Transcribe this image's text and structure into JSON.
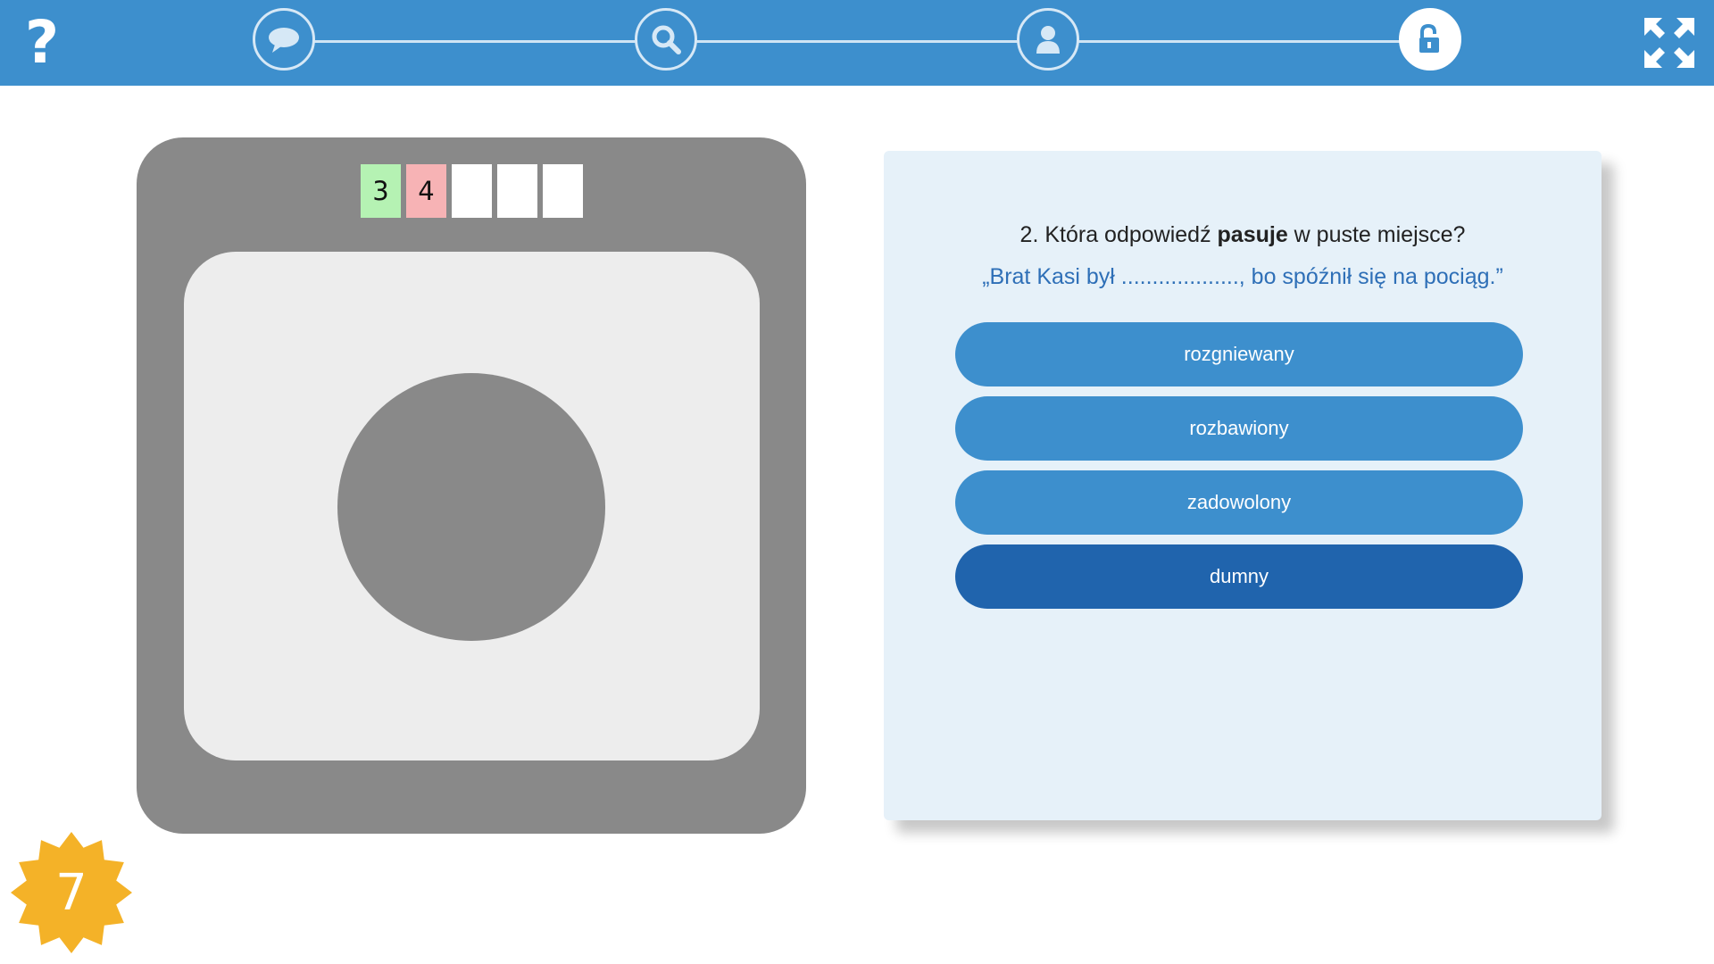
{
  "toolbar": {
    "help_label": "?",
    "steps": [
      {
        "icon": "speech-bubble-icon",
        "state": "done"
      },
      {
        "icon": "magnifier-icon",
        "state": "done"
      },
      {
        "icon": "user-icon",
        "state": "done"
      },
      {
        "icon": "unlock-icon",
        "state": "active"
      }
    ],
    "fullscreen_icon": "fullscreen-arrows-icon"
  },
  "code_slots": [
    "3",
    "4",
    "",
    "",
    ""
  ],
  "code_slot_states": [
    "correct",
    "wrong",
    "empty",
    "empty",
    "empty"
  ],
  "quiz": {
    "question_prefix": "2. Która odpowiedź ",
    "question_bold": "pasuje",
    "question_suffix": " w puste miejsce?",
    "sentence": "„Brat Kasi był ..................., bo spóźnił się na pociąg.”",
    "answers": [
      "rozgniewany",
      "rozbawiony",
      "zadowolony",
      "dumny"
    ],
    "selected_answer": "dumny"
  },
  "badge": {
    "value": "7",
    "color": "#f4b228"
  },
  "colors": {
    "toolbar": "#3d8fcd",
    "answer": "#3d8fcd",
    "answer_selected": "#2064ad",
    "slot_correct": "#b5f2b3",
    "slot_wrong": "#f7b3b5"
  }
}
